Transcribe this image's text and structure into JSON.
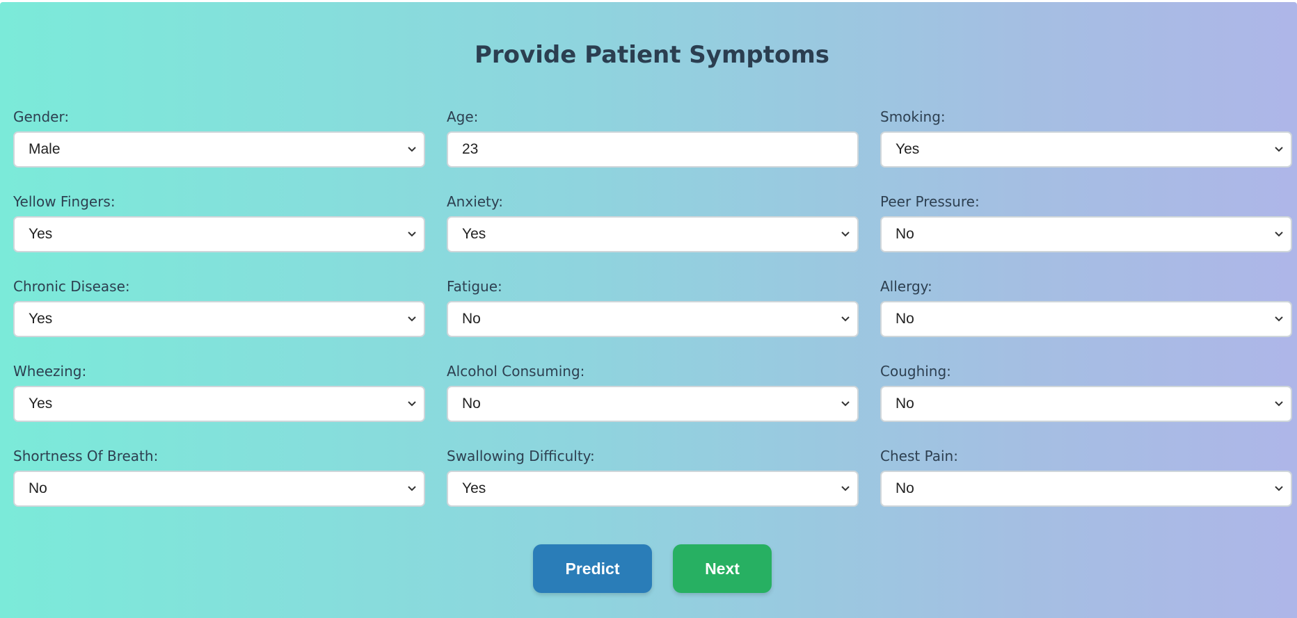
{
  "title": "Provide Patient Symptoms",
  "fields": [
    {
      "label": "Gender:",
      "value": "Male",
      "kind": "select"
    },
    {
      "label": "Age:",
      "value": "23",
      "kind": "input"
    },
    {
      "label": "Smoking:",
      "value": "Yes",
      "kind": "select"
    },
    {
      "label": "Yellow Fingers:",
      "value": "Yes",
      "kind": "select"
    },
    {
      "label": "Anxiety:",
      "value": "Yes",
      "kind": "select"
    },
    {
      "label": "Peer Pressure:",
      "value": "No",
      "kind": "select"
    },
    {
      "label": "Chronic Disease:",
      "value": "Yes",
      "kind": "select"
    },
    {
      "label": "Fatigue:",
      "value": "No",
      "kind": "select"
    },
    {
      "label": "Allergy:",
      "value": "No",
      "kind": "select"
    },
    {
      "label": "Wheezing:",
      "value": "Yes",
      "kind": "select"
    },
    {
      "label": "Alcohol Consuming:",
      "value": "No",
      "kind": "select"
    },
    {
      "label": "Coughing:",
      "value": "No",
      "kind": "select"
    },
    {
      "label": "Shortness Of Breath:",
      "value": "No",
      "kind": "select"
    },
    {
      "label": "Swallowing Difficulty:",
      "value": "Yes",
      "kind": "select"
    },
    {
      "label": "Chest Pain:",
      "value": "No",
      "kind": "select"
    }
  ],
  "buttons": {
    "predict_label": "Predict",
    "next_label": "Next"
  },
  "icons": {
    "dropdown": "chevron-down-icon"
  },
  "colors": {
    "title": "#2b3e50",
    "predict_button": "#2a7db8",
    "next_button": "#27b062",
    "gradient_start": "#7bead9",
    "gradient_end": "#aeb6e8"
  }
}
